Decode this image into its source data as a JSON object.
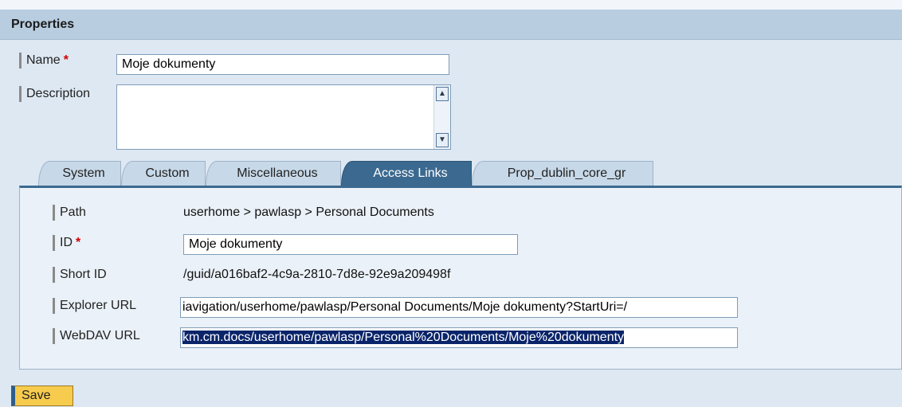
{
  "panel": {
    "title": "Properties"
  },
  "form": {
    "name_label": "Name",
    "name_required": "*",
    "name_value": "Moje dokumenty",
    "description_label": "Description",
    "description_value": ""
  },
  "tabs": [
    {
      "label": "System",
      "active": false
    },
    {
      "label": "Custom",
      "active": false
    },
    {
      "label": "Miscellaneous",
      "active": false
    },
    {
      "label": "Access Links",
      "active": true
    },
    {
      "label": "Prop_dublin_core_gr",
      "active": false
    }
  ],
  "access_links": {
    "path_label": "Path",
    "path_value": "userhome > pawlasp > Personal Documents",
    "id_label": "ID",
    "id_required": "*",
    "id_value": "Moje dokumenty",
    "short_id_label": "Short ID",
    "short_id_value": "/guid/a016baf2-4c9a-2810-7d8e-92e9a209498f",
    "explorer_url_label": "Explorer URL",
    "explorer_url_value": "iavigation/userhome/pawlasp/Personal Documents/Moje dokumenty?StartUri=/",
    "webdav_url_label": "WebDAV URL",
    "webdav_url_value": "km.cm.docs/userhome/pawlasp/Personal%20Documents/Moje%20dokumenty"
  },
  "footer": {
    "save_label": "Save"
  },
  "icons": {
    "scroll_up": "scroll-up-arrow-icon",
    "scroll_down": "scroll-down-arrow-icon"
  },
  "colors": {
    "header_bg": "#b8cde0",
    "panel_bg": "#dde8f3",
    "active_tab": "#3b6990",
    "save_button": "#f7cb4d",
    "selection": "#0a246a"
  }
}
